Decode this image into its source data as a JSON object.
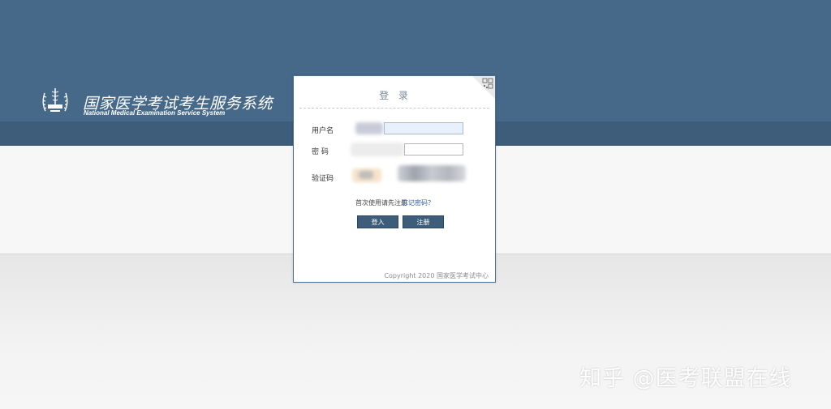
{
  "header": {
    "title": "国家医学考试考生服务系统",
    "subtitle": "National Medical Examination Service System",
    "emblem_icon": "medical-caduceus-emblem"
  },
  "login": {
    "title": "登 录",
    "username_label": "用户名",
    "password_label": "密 码",
    "captcha_label": "验证码",
    "register_prompt": "首次使用请先注册",
    "forgot_password": "忘记密码？",
    "login_button": "登入",
    "register_button": "注册",
    "qr_icon": "qr-code-icon"
  },
  "footer": {
    "copyright": "Copyright 2020 国家医学考试中心"
  },
  "watermark": "知乎 @医考联盟在线",
  "colors": {
    "header_band": "#46698a",
    "header_dark_band": "#3d5d7a",
    "button_bg": "#3d5d7a",
    "link": "#2a5ca8"
  }
}
